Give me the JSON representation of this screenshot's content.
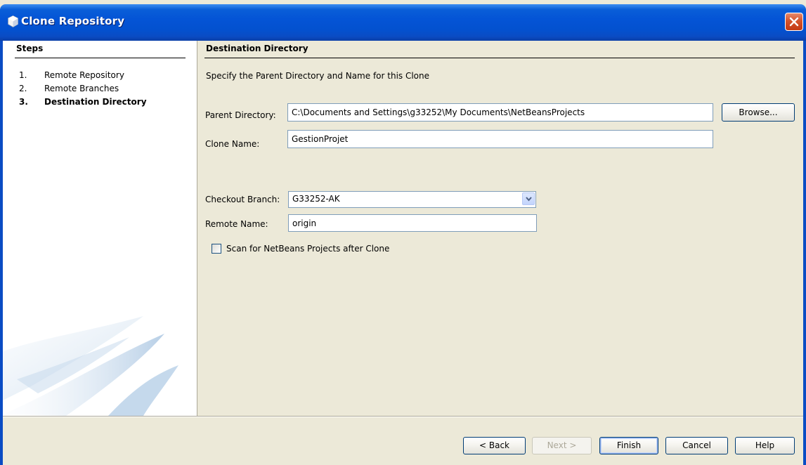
{
  "window": {
    "title": "Clone Repository",
    "icon": "netbeans-cube-icon",
    "close_icon": "close-icon"
  },
  "steps": {
    "title": "Steps",
    "items": [
      {
        "num": "1.",
        "label": "Remote Repository"
      },
      {
        "num": "2.",
        "label": "Remote Branches"
      },
      {
        "num": "3.",
        "label": "Destination Directory",
        "current": true
      }
    ]
  },
  "panel": {
    "title": "Destination Directory",
    "description": "Specify the Parent Directory and Name for this Clone",
    "parent_directory": {
      "label": "Parent Directory:",
      "value": "C:\\Documents and Settings\\g33252\\My Documents\\NetBeansProjects"
    },
    "browse_button": "Browse...",
    "clone_name": {
      "label": "Clone Name:",
      "value": "GestionProjet"
    },
    "checkout_branch": {
      "label": "Checkout Branch:",
      "value": "G33252-AK"
    },
    "remote_name": {
      "label": "Remote Name:",
      "value": "origin"
    },
    "scan_checkbox": {
      "label": "Scan for NetBeans Projects after Clone",
      "checked": false
    }
  },
  "buttons": {
    "back": "< Back",
    "next": "Next >",
    "finish": "Finish",
    "cancel": "Cancel",
    "help": "Help"
  },
  "colors": {
    "titlebar": "#0454d6",
    "dialog_bg": "#ece9d8",
    "close_button": "#d4532c",
    "field_border": "#7f9db9"
  }
}
